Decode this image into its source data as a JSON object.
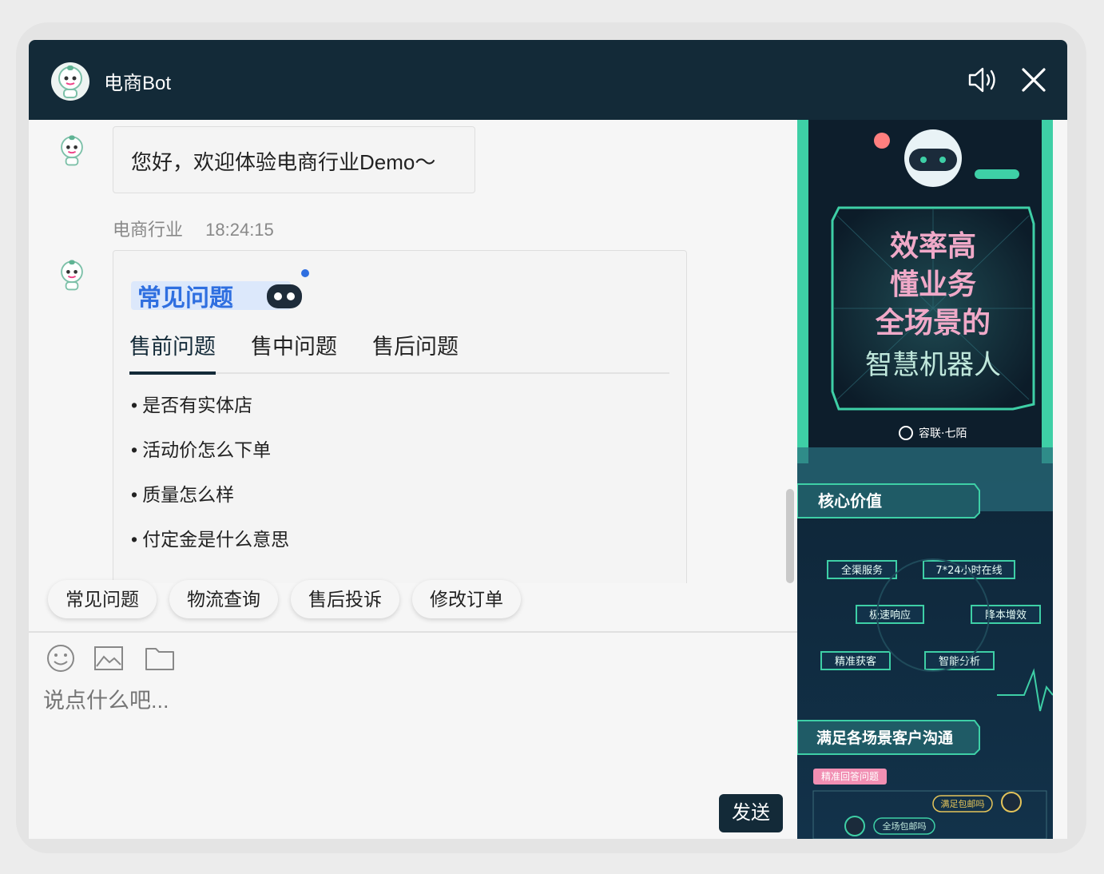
{
  "header": {
    "title": "电商Bot",
    "icons": [
      "bot-avatar",
      "speaker-icon",
      "close-icon"
    ]
  },
  "messages": [
    {
      "type": "text",
      "text": "您好，欢迎体验电商行业Demo～"
    },
    {
      "type": "faq",
      "sender": "电商行业",
      "time": "18:24:15",
      "faq_title": "常见问题",
      "tabs": [
        "售前问题",
        "售中问题",
        "售后问题"
      ],
      "active_tab": 0,
      "questions": [
        "是否有实体店",
        "活动价怎么下单",
        "质量怎么样",
        "付定金是什么意思"
      ]
    }
  ],
  "quick_replies": [
    "常见问题",
    "物流查询",
    "售后投诉",
    "修改订单"
  ],
  "toolbar": {
    "icons": [
      "emoji-icon",
      "image-icon",
      "folder-icon"
    ]
  },
  "input": {
    "placeholder": "说点什么吧..."
  },
  "send_label": "发送",
  "banner": {
    "headline": [
      "效率高",
      "懂业务",
      "全场景的",
      "智慧机器人"
    ],
    "brand": "容联·七陌",
    "section1": "核心价值",
    "features": [
      "全渠服务",
      "7*24小时在线",
      "极速响应",
      "降本增效",
      "精准获客",
      "智能分析"
    ],
    "section2": "满足各场景客户沟通",
    "tag": "精准回答问题",
    "bubble1": "满足包邮吗",
    "bubble2": "全场包邮吗"
  },
  "colors": {
    "header_bg": "#132a38",
    "accent": "#132a38",
    "banner_bg": "#0e1d2b",
    "banner_green": "#3ecfa6",
    "faq_blue": "#2f6fe0"
  }
}
